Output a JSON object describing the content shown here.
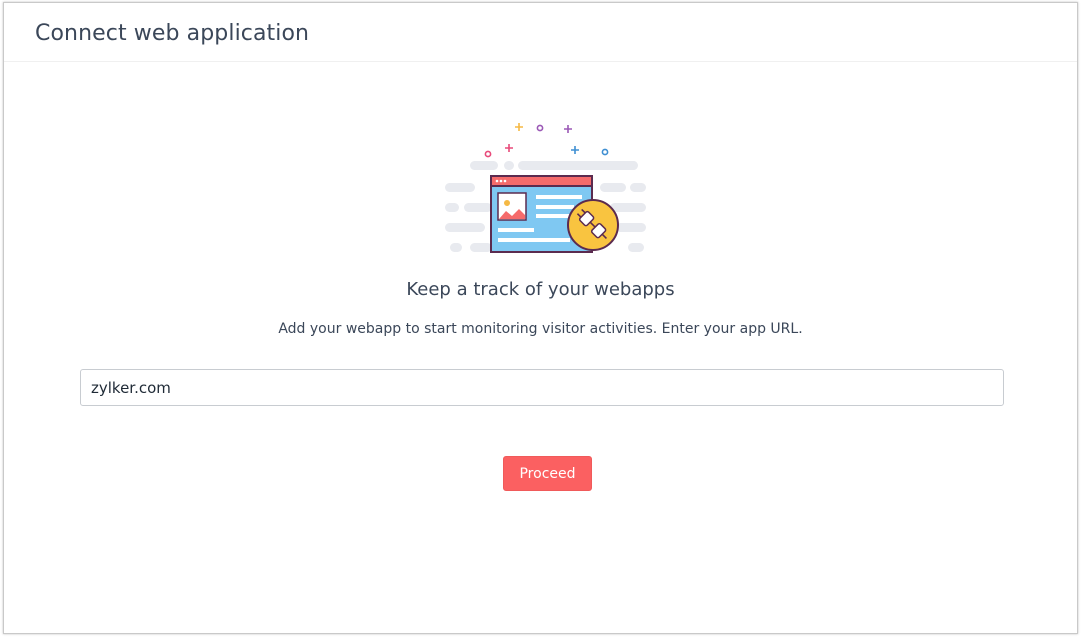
{
  "window": {
    "title": "Connect web application"
  },
  "empty_state": {
    "illustration": "webapp-plug-illustration",
    "heading": "Keep a track of your webapps",
    "description": "Add your webapp to start monitoring visitor activities. Enter your app URL."
  },
  "url_input": {
    "value": "zylker.com",
    "placeholder": ""
  },
  "actions": {
    "proceed_label": "Proceed"
  },
  "colors": {
    "primary_button": "#fb6061",
    "title_text": "#3b4759",
    "browser_frame": "#f56b6b",
    "browser_body": "#7fc8f2",
    "plug_circle": "#f9c440"
  }
}
